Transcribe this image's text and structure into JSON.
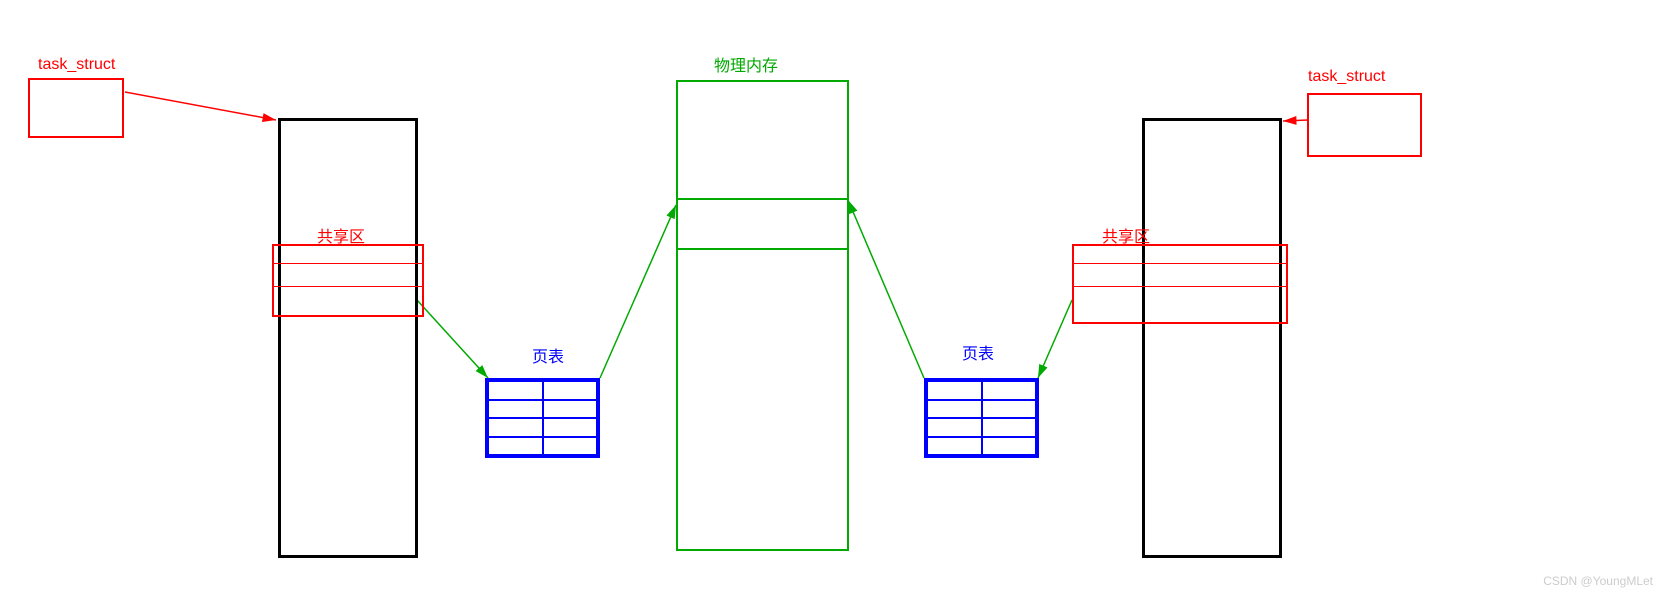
{
  "labels": {
    "task_struct_left": "task_struct",
    "task_struct_right": "task_struct",
    "shared_left": "共享区",
    "shared_right": "共享区",
    "page_table_left": "页表",
    "page_table_right": "页表",
    "physical_memory": "物理内存",
    "watermark": "CSDN @YoungMLet"
  },
  "colors": {
    "red": "#ff0000",
    "green": "#00aa00",
    "blue": "#0000ff",
    "black": "#000000"
  }
}
